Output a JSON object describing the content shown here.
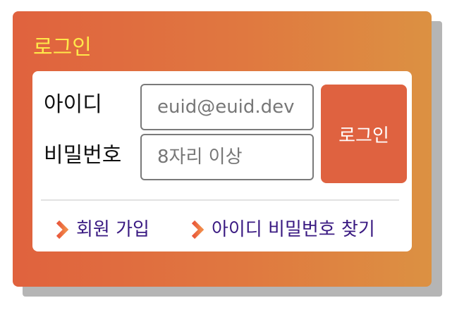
{
  "login_panel": {
    "title": "로그인",
    "id_label": "아이디",
    "id_placeholder": "euid@euid.dev",
    "password_label": "비밀번호",
    "password_placeholder": "8자리 이상",
    "login_button_label": "로그인",
    "links": [
      {
        "label": "회원 가입",
        "icon": "chevron-right-icon"
      },
      {
        "label": "아이디 비밀번호 찾기",
        "icon": "chevron-right-icon"
      }
    ]
  },
  "colors": {
    "gradient_start": "#e0623e",
    "gradient_end": "#dc9142",
    "title_color": "#ffe84a",
    "button_color": "#df6240",
    "link_color": "#3a1a82",
    "shadow_color": "#b5b5b5"
  }
}
